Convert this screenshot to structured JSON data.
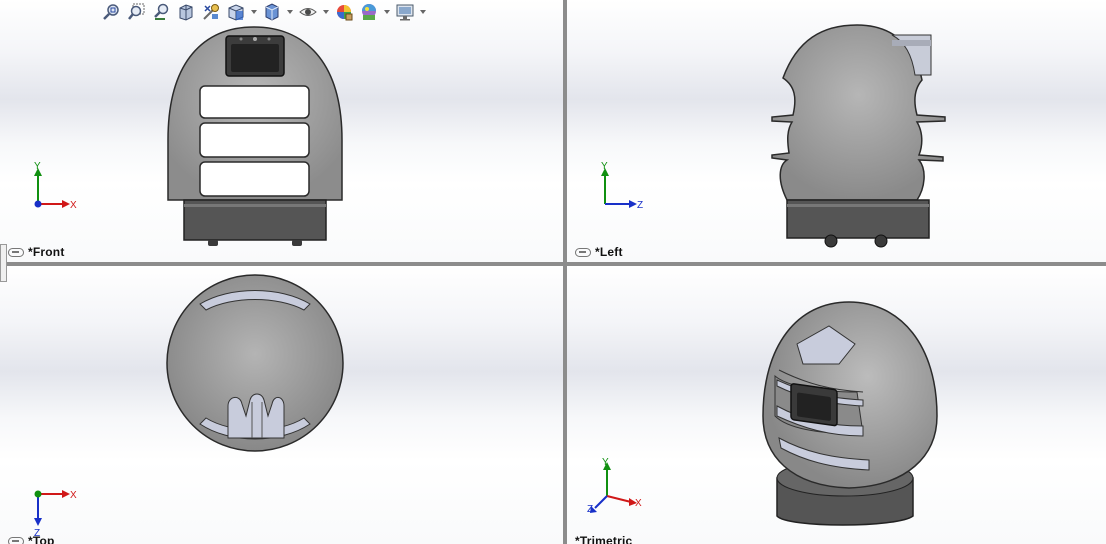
{
  "viewports": {
    "front": {
      "label": "*Front",
      "axes": [
        "Y",
        "X"
      ]
    },
    "left": {
      "label": "*Left",
      "axes": [
        "Y",
        "Z"
      ]
    },
    "top": {
      "label": "*Top",
      "axes": [
        "X",
        "Z"
      ]
    },
    "trimetric": {
      "label": "*Trimetric",
      "axes": [
        "Y",
        "X",
        "Z"
      ]
    }
  },
  "toolbar": {
    "icons": [
      "zoom-to-fit-icon",
      "zoom-to-area-icon",
      "previous-view-icon",
      "section-view-icon",
      "dynamic-annotation-view-icon",
      "view-orientation-icon",
      "display-style-icon",
      "hide-show-items-icon",
      "edit-appearance-icon",
      "apply-scene-icon",
      "view-settings-icon"
    ]
  },
  "colors": {
    "axis_x": "#d01818",
    "axis_y": "#109010",
    "axis_z": "#1830c8",
    "model_body": "#a4a4a4",
    "model_base": "#5a5a5a",
    "shelf": "#c8ccdc"
  }
}
